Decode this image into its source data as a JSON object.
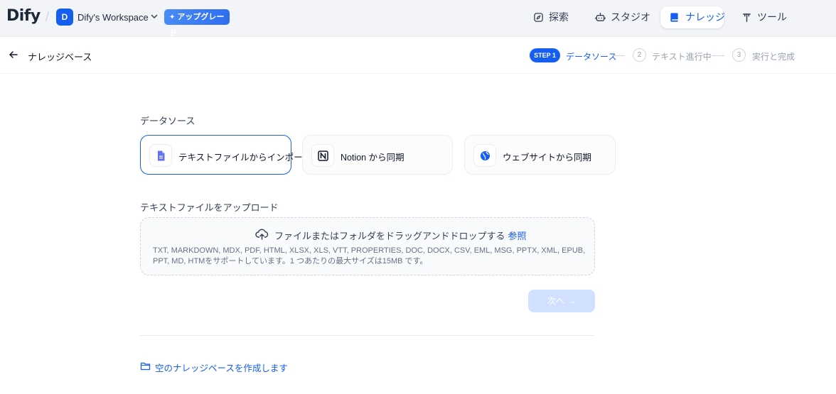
{
  "app": {
    "logo_text": "Dify",
    "workspace_initial": "D",
    "workspace_name": "Dify's Workspace",
    "upgrade_label": "アップグレード"
  },
  "nav": {
    "explore": "探索",
    "studio": "スタジオ",
    "knowledge": "ナレッジ",
    "tools": "ツール"
  },
  "header": {
    "title": "ナレッジベース"
  },
  "steps": {
    "step1_badge": "STEP 1",
    "step1_label": "データソース",
    "step2_num": "2",
    "step2_label": "テキスト進行中",
    "step3_num": "3",
    "step3_label": "実行と完成"
  },
  "datasource": {
    "section_label": "データソース",
    "options": [
      {
        "label": "テキストファイルからインポート",
        "icon": "file-text-icon",
        "selected": true
      },
      {
        "label": "Notion から同期",
        "icon": "notion-icon",
        "selected": false
      },
      {
        "label": "ウェブサイトから同期",
        "icon": "globe-icon",
        "selected": false
      }
    ]
  },
  "upload": {
    "section_label": "テキストファイルをアップロード",
    "drop_text": "ファイルまたはフォルダをドラッグアンドドロップする",
    "browse_label": "参照",
    "hint": "TXT, MARKDOWN, MDX, PDF, HTML, XLSX, XLS, VTT, PROPERTIES, DOC, DOCX, CSV, EML, MSG, PPTX, XML, EPUB, PPT, MD, HTMをサポートしています。1 つあたりの最大サイズは15MB です。"
  },
  "actions": {
    "next_label": "次へ",
    "create_empty_label": "空のナレッジベースを作成します"
  },
  "colors": {
    "accent": "#155eef",
    "next_disabled": "#d1e0ff",
    "topbar_bg": "#f2f4f7"
  }
}
